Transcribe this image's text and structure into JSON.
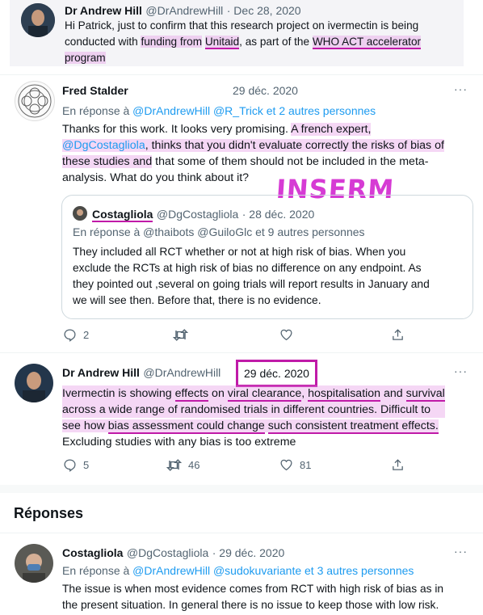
{
  "tweet_top": {
    "name": "Dr Andrew Hill",
    "handle": "@DrAndrewHill",
    "date": "· Dec 28, 2020",
    "line1": "Hi Patrick,   just to confirm that this research project on ivermectin is being",
    "line2a": "conducted with ",
    "line2b": "funding from",
    "line2c": "Unitaid",
    "line2d": ", as part of the ",
    "line2e": "WHO ACT accelerator",
    "line3": "program"
  },
  "tweet_fred": {
    "name": "Fred Stalder",
    "date": "29 déc. 2020",
    "reply_prefix": "En réponse à ",
    "reply_users": "@DrAndrewHill @R_Trick",
    "reply_others": " et 2 autres personnes",
    "l1a": "Thanks for this work. It looks very promising. ",
    "l1b": "A french expert,",
    "l2a": "@DgCostagliola",
    "l2b": ", thinks that you didn't evaluate correctly the risks of bias of",
    "l3a": "these studies and",
    "l3b": " that some of them should not be included in the meta-",
    "l4": "analysis. What do you think about it?",
    "annotation": "INSERM",
    "quote": {
      "name": "Costagliola",
      "handle": "@DgCostagliola",
      "date": "· 28 déc. 2020",
      "reply_line": "En réponse à @thaibots @GuiloGlc et 9 autres personnes",
      "l1": "They included all RCT whether or not at high risk of bias. When you",
      "l2": "exclude the RCTs at high risk of bias no difference on any endpoint. As",
      "l3": "they pointed out ,several on going trials will report results in January and",
      "l4": "we will see then. Before that, there is no evidence."
    },
    "replies": "2",
    "retweets": "",
    "likes": ""
  },
  "tweet_hill": {
    "name": "Dr Andrew Hill",
    "handle": "@DrAndrewHill",
    "date": "29 déc. 2020",
    "l1a": "Ivermectin is showing ",
    "l1b": "effects",
    "l1c": " on ",
    "l1d": "viral clearance",
    "l1e": ", ",
    "l1f": "hospitalisation",
    "l1g": " and ",
    "l1h": "survival",
    "l2": "across a wide range of randomised trials in different countries.  Difficult to",
    "l3a": "see how ",
    "l3b": "bias assessment could change",
    "l3c": " ",
    "l3d": "such consistent treatment effects.",
    "l4": "Excluding studies with any bias is too extreme",
    "replies": "5",
    "retweets": "46",
    "likes": "81"
  },
  "section_title": "Réponses",
  "tweet_reply": {
    "name": "Costagliola",
    "handle": "@DgCostagliola",
    "date": "· 29 déc. 2020",
    "reply_prefix": "En réponse à ",
    "reply_users": "@DrAndrewHill @sudokuvariante",
    "reply_others": " et 3 autres personnes",
    "l1": "The issue is when most evidence comes from RCT with high risk of bias as in",
    "l2": "the present situation. In general there is no issue to keep those with low risk."
  },
  "more_label": "···"
}
